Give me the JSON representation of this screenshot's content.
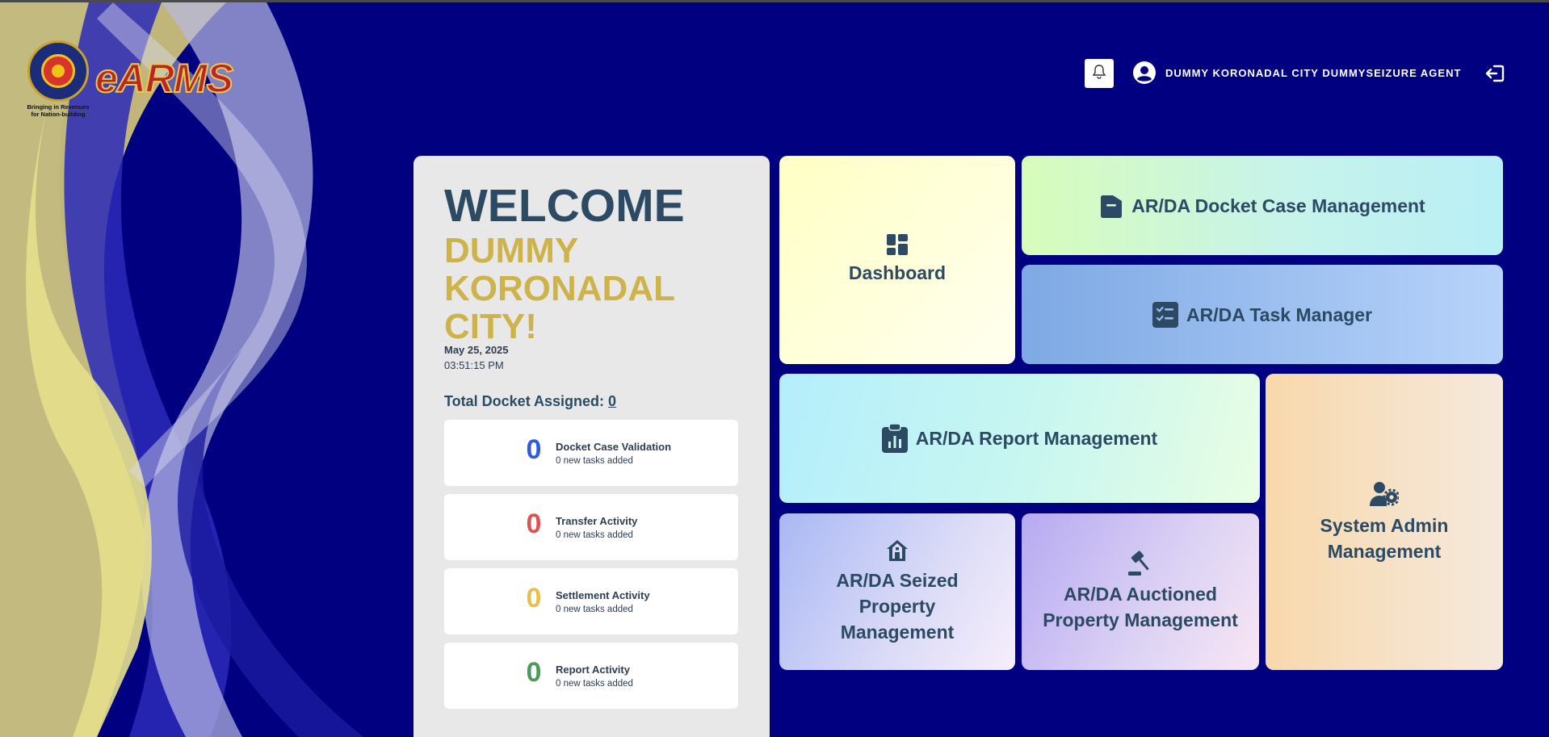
{
  "app": {
    "logo_text": "eARMS",
    "seal_tagline": "Bringing in Revenues for Nation-building"
  },
  "header": {
    "user_name": "DUMMY KORONADAL CITY DUMMYSEIZURE AGENT"
  },
  "welcome": {
    "title": "WELCOME",
    "name": "DUMMY KORONADAL CITY!",
    "date": "May 25, 2025",
    "time": "03:51:15 PM",
    "total_label": "Total Docket Assigned:",
    "total_count": "0"
  },
  "stats": [
    {
      "count": "0",
      "title": "Docket Case Validation",
      "subtitle": "0 new tasks added",
      "color": "#2f5be0"
    },
    {
      "count": "0",
      "title": "Transfer Activity",
      "subtitle": "0 new tasks added",
      "color": "#e05252"
    },
    {
      "count": "0",
      "title": "Settlement Activity",
      "subtitle": "0 new tasks added",
      "color": "#e8be4c"
    },
    {
      "count": "0",
      "title": "Report Activity",
      "subtitle": "0 new tasks added",
      "color": "#4f9a57"
    }
  ],
  "tiles": {
    "dashboard": {
      "label": "Dashboard",
      "icon": "dashboard-icon"
    },
    "docket": {
      "label": "AR/DA Docket Case Management",
      "icon": "folder-icon"
    },
    "task": {
      "label": "AR/DA Task Manager",
      "icon": "checklist-icon"
    },
    "report": {
      "label": "AR/DA Report Management",
      "icon": "clipboard-chart-icon"
    },
    "admin": {
      "label": "System Admin Management",
      "icon": "user-gear-icon"
    },
    "seized": {
      "label": "AR/DA Seized Property Management",
      "icon": "house-icon"
    },
    "auction": {
      "label": "AR/DA Auctioned Property Management",
      "icon": "gavel-icon"
    }
  },
  "colors": {
    "background": "#000080",
    "tile_text": "#2c4a63",
    "welcome_name": "#cdb34a"
  }
}
